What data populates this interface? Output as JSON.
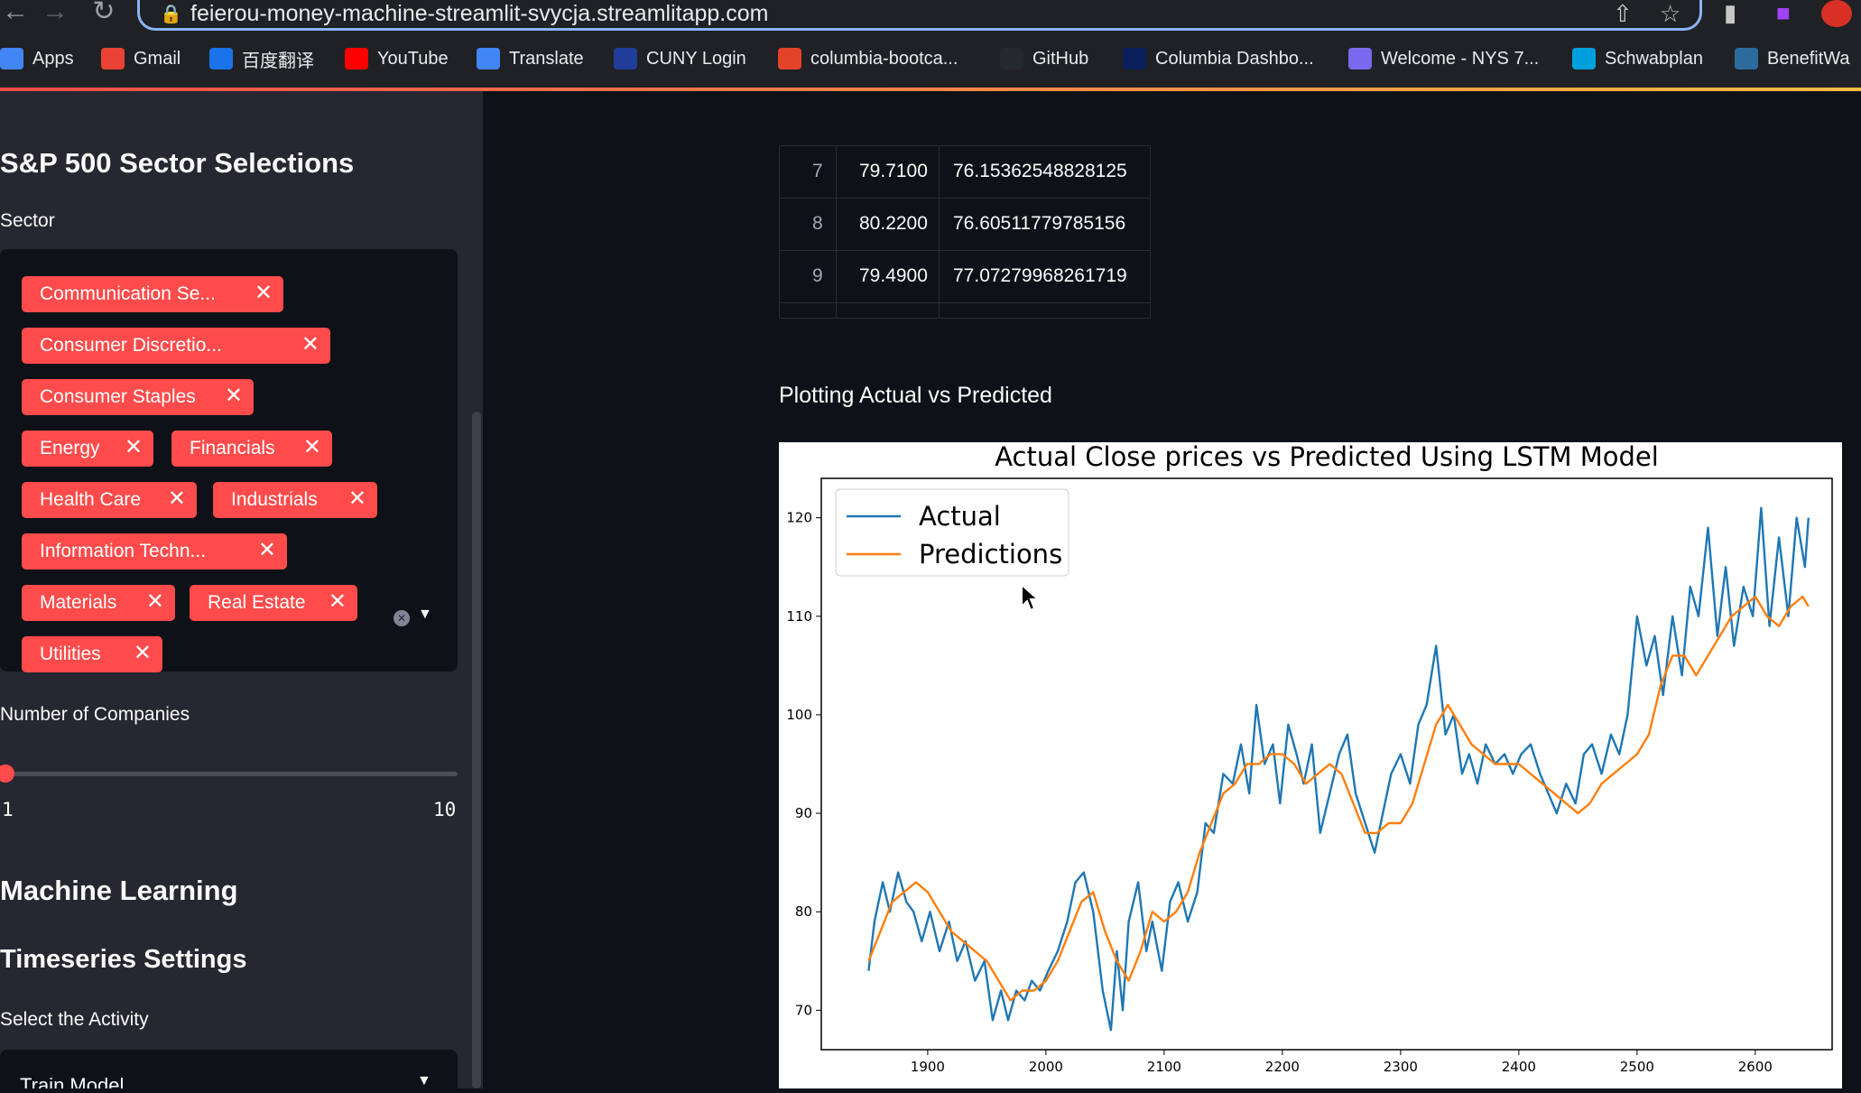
{
  "browser": {
    "url": "feierou-money-machine-streamlit-svycja.streamlitapp.com",
    "bookmarks": [
      {
        "label": "Apps",
        "icon": "apps-grid-icon"
      },
      {
        "label": "Gmail",
        "icon": "gmail-icon"
      },
      {
        "label": "百度翻译",
        "icon": "baidu-translate-icon"
      },
      {
        "label": "YouTube",
        "icon": "youtube-icon"
      },
      {
        "label": "Translate",
        "icon": "translate-icon"
      },
      {
        "label": "CUNY Login",
        "icon": "cuny-icon"
      },
      {
        "label": "columbia-bootca...",
        "icon": "gitlab-icon"
      },
      {
        "label": "GitHub",
        "icon": "github-icon"
      },
      {
        "label": "Columbia Dashbo...",
        "icon": "columbia-icon"
      },
      {
        "label": "Welcome - NYS 7...",
        "icon": "yahoo-icon"
      },
      {
        "label": "Schwabplan",
        "icon": "schwab-icon"
      },
      {
        "label": "BenefitWa",
        "icon": "benefit-icon"
      }
    ]
  },
  "sidebar": {
    "title": "S&P 500 Sector Selections",
    "sector_label": "Sector",
    "sectors": [
      "Communication Se...",
      "Consumer Discretio...",
      "Consumer Staples",
      "Energy",
      "Financials",
      "Health Care",
      "Industrials",
      "Information Techn...",
      "Materials",
      "Real Estate",
      "Utilities"
    ],
    "companies_label": "Number of Companies",
    "slider": {
      "min": "1",
      "max": "10",
      "value": 1
    },
    "ml_title": "Machine Learning",
    "ts_title": "Timeseries Settings",
    "activity_label": "Select the Activity",
    "activity_value": "Train Model"
  },
  "main": {
    "table_rows": [
      {
        "idx": "7",
        "actual": "79.7100",
        "pred": "76.15362548828125"
      },
      {
        "idx": "8",
        "actual": "80.2200",
        "pred": "76.60511779785156"
      },
      {
        "idx": "9",
        "actual": "79.4900",
        "pred": "77.07279968261719"
      }
    ],
    "plot_heading": "Plotting Actual vs Predicted"
  },
  "chart_data": {
    "type": "line",
    "title": "Actual Close prices vs Predicted Using LSTM Model",
    "xlabel": "",
    "ylabel": "",
    "xlim": [
      1810,
      2665
    ],
    "ylim": [
      66,
      124
    ],
    "xticks": [
      1900,
      2000,
      2100,
      2200,
      2300,
      2400,
      2500,
      2600
    ],
    "yticks": [
      70,
      80,
      90,
      100,
      110,
      120
    ],
    "legend_position": "top-left",
    "grid": false,
    "series": [
      {
        "name": "Actual",
        "color": "#1f77b4",
        "x": [
          1850,
          1855,
          1862,
          1868,
          1875,
          1882,
          1888,
          1895,
          1902,
          1910,
          1918,
          1925,
          1932,
          1940,
          1948,
          1955,
          1962,
          1968,
          1975,
          1982,
          1988,
          1995,
          2002,
          2010,
          2018,
          2025,
          2032,
          2040,
          2048,
          2055,
          2060,
          2065,
          2070,
          2078,
          2085,
          2090,
          2098,
          2105,
          2112,
          2120,
          2128,
          2135,
          2142,
          2150,
          2158,
          2165,
          2172,
          2178,
          2185,
          2192,
          2198,
          2205,
          2212,
          2218,
          2225,
          2232,
          2240,
          2248,
          2255,
          2262,
          2270,
          2278,
          2285,
          2292,
          2300,
          2308,
          2315,
          2322,
          2330,
          2338,
          2345,
          2352,
          2358,
          2365,
          2372,
          2380,
          2388,
          2395,
          2402,
          2410,
          2418,
          2425,
          2432,
          2440,
          2448,
          2455,
          2462,
          2470,
          2478,
          2485,
          2492,
          2500,
          2508,
          2515,
          2522,
          2530,
          2538,
          2545,
          2552,
          2560,
          2568,
          2575,
          2582,
          2590,
          2598,
          2605,
          2612,
          2620,
          2628,
          2635,
          2642,
          2645
        ],
        "y": [
          74,
          79,
          83,
          80,
          84,
          81,
          80,
          77,
          80,
          76,
          79,
          75,
          77,
          73,
          75,
          69,
          72,
          69,
          72,
          71,
          73,
          72,
          74,
          76,
          79,
          83,
          84,
          80,
          72,
          68,
          76,
          70,
          79,
          83,
          76,
          79,
          74,
          81,
          83,
          79,
          82,
          89,
          88,
          94,
          93,
          97,
          92,
          101,
          95,
          97,
          91,
          99,
          96,
          93,
          97,
          88,
          92,
          96,
          98,
          92,
          89,
          86,
          90,
          94,
          96,
          93,
          99,
          101,
          107,
          98,
          100,
          94,
          96,
          93,
          97,
          95,
          96,
          94,
          96,
          97,
          94,
          92,
          90,
          93,
          91,
          96,
          97,
          94,
          98,
          96,
          100,
          110,
          105,
          108,
          102,
          110,
          104,
          113,
          110,
          119,
          108,
          115,
          107,
          113,
          110,
          121,
          109,
          118,
          110,
          120,
          115,
          120
        ]
      },
      {
        "name": "Predictions",
        "color": "#ff7f0e",
        "x": [
          1850,
          1860,
          1870,
          1880,
          1890,
          1900,
          1910,
          1920,
          1930,
          1940,
          1950,
          1960,
          1970,
          1980,
          1990,
          2000,
          2010,
          2020,
          2030,
          2040,
          2050,
          2060,
          2070,
          2080,
          2090,
          2100,
          2110,
          2120,
          2130,
          2140,
          2150,
          2160,
          2170,
          2180,
          2190,
          2200,
          2210,
          2220,
          2230,
          2240,
          2250,
          2260,
          2270,
          2280,
          2290,
          2300,
          2310,
          2320,
          2330,
          2340,
          2350,
          2360,
          2370,
          2380,
          2390,
          2400,
          2410,
          2420,
          2430,
          2440,
          2450,
          2460,
          2470,
          2480,
          2490,
          2500,
          2510,
          2520,
          2530,
          2540,
          2550,
          2560,
          2570,
          2580,
          2590,
          2600,
          2610,
          2620,
          2630,
          2640,
          2645
        ],
        "y": [
          75,
          78,
          81,
          82,
          83,
          82,
          80,
          78,
          77,
          76,
          75,
          73,
          71,
          72,
          72,
          73,
          75,
          78,
          81,
          82,
          78,
          75,
          73,
          76,
          80,
          79,
          80,
          82,
          86,
          89,
          92,
          93,
          95,
          95,
          96,
          96,
          95,
          93,
          94,
          95,
          94,
          91,
          88,
          88,
          89,
          89,
          91,
          95,
          99,
          101,
          99,
          97,
          96,
          95,
          95,
          95,
          94,
          93,
          92,
          91,
          90,
          91,
          93,
          94,
          95,
          96,
          98,
          103,
          106,
          106,
          104,
          106,
          108,
          110,
          111,
          112,
          110,
          109,
          111,
          112,
          111
        ]
      }
    ]
  }
}
